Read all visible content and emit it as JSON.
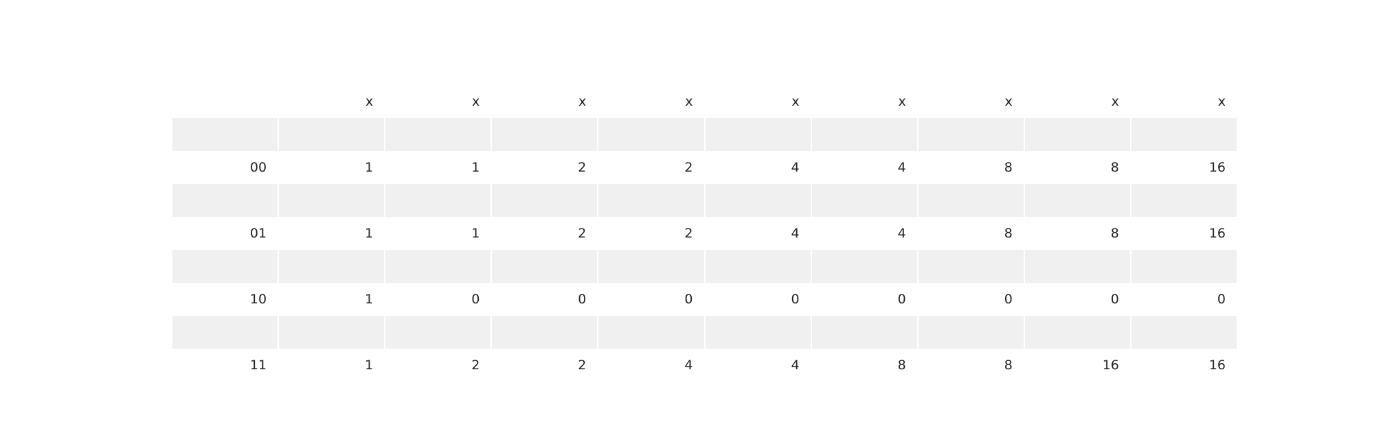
{
  "chart_data": {
    "type": "table",
    "columns": [
      "",
      "x",
      "x",
      "x",
      "x",
      "x",
      "x",
      "x",
      "x",
      "x"
    ],
    "rows": [
      {
        "label": "00",
        "values": [
          "1",
          "1",
          "2",
          "2",
          "4",
          "4",
          "8",
          "8",
          "16"
        ]
      },
      {
        "label": "01",
        "values": [
          "1",
          "1",
          "2",
          "2",
          "4",
          "4",
          "8",
          "8",
          "16"
        ]
      },
      {
        "label": "10",
        "values": [
          "1",
          "0",
          "0",
          "0",
          "0",
          "0",
          "0",
          "0",
          "0"
        ]
      },
      {
        "label": "11",
        "values": [
          "1",
          "2",
          "2",
          "4",
          "4",
          "8",
          "8",
          "16",
          "16"
        ]
      }
    ],
    "title": "",
    "colors": {
      "band": "#f0f0f0",
      "row": "#ffffff",
      "text": "#222222"
    }
  }
}
